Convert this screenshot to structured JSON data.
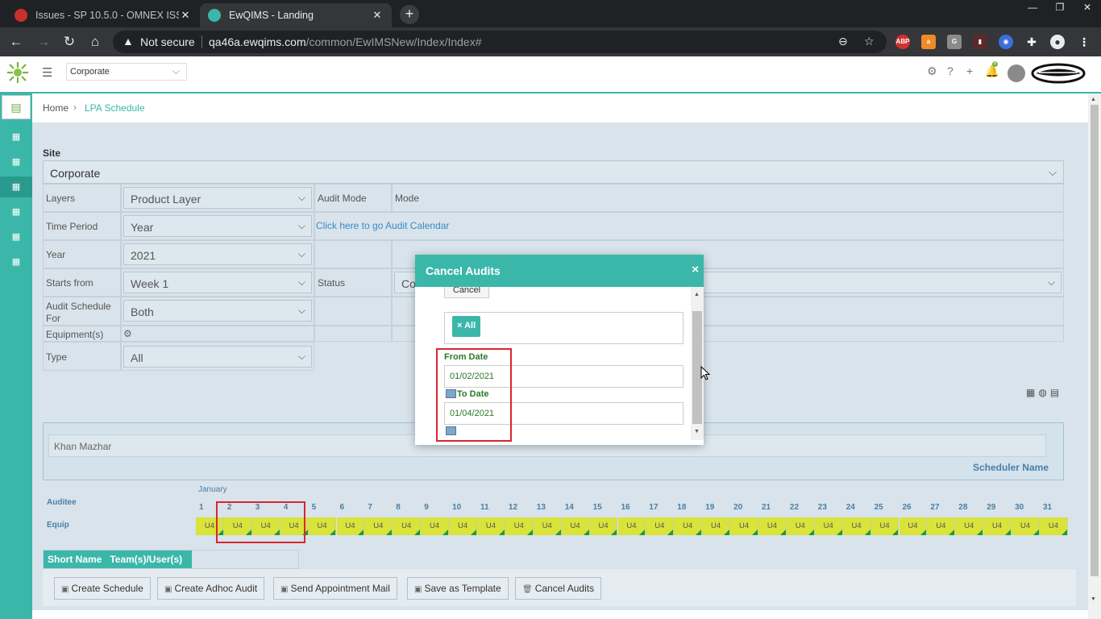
{
  "browser": {
    "tabs": [
      {
        "title": "Issues - SP 10.5.0 - OMNEX ISSUE",
        "active": false
      },
      {
        "title": "EwQIMS - Landing",
        "active": true
      }
    ],
    "new_tab": "+",
    "url_warning": "Not secure",
    "url_host": "qa46a.ewqims.com",
    "url_path": "/common/EwIMSNew/Index/Index#",
    "extensions": [
      "ABP"
    ]
  },
  "header": {
    "site_select": "Corporate",
    "brand": "CUMMINS",
    "notification_count": "0"
  },
  "breadcrumb": {
    "home": "Home",
    "separator": "›",
    "current": "LPA Schedule"
  },
  "form": {
    "site_label": "Site",
    "site_value": "Corporate",
    "layers_label": "Layers",
    "layers_value": "Product Layer",
    "audit_mode_label": "Audit Mode",
    "audit_mode_value": "Mode",
    "time_period_label": "Time Period",
    "time_period_value": "Year",
    "calendar_link": "Click here to go Audit Calendar",
    "year_label": "Year",
    "year_value": "2021",
    "starts_from_label": "Starts from",
    "starts_from_value": "Week 1",
    "status_label": "Status",
    "status_value": "Co",
    "schedule_for_label_1": "Audit Schedule",
    "schedule_for_label_2": "For",
    "schedule_for_value": "Both",
    "equipment_label": "Equipment(s)",
    "type_label": "Type",
    "type_value": "All"
  },
  "scheduler": {
    "value": "Khan Mazhar",
    "label": "Scheduler Name"
  },
  "grid": {
    "auditee_label": "Auditee",
    "month": "January",
    "days": [
      "1",
      "2",
      "3",
      "4",
      "5",
      "6",
      "7",
      "8",
      "9",
      "10",
      "11",
      "12",
      "13",
      "14",
      "15",
      "16",
      "17",
      "18",
      "19",
      "20",
      "21",
      "22",
      "23",
      "24",
      "25",
      "26",
      "27",
      "28",
      "29",
      "30",
      "31"
    ],
    "row_label": "Equip",
    "cell_value": "U4"
  },
  "short_table": {
    "header": "Short Name   Team(s)/User(s)"
  },
  "buttons": {
    "create_schedule": "Create Schedule",
    "create_adhoc": "Create Adhoc Audit",
    "send_mail": "Send Appointment Mail",
    "save_template": "Save as Template",
    "cancel_audits": "Cancel Audits"
  },
  "dialog": {
    "title": "Cancel Audits",
    "close": "×",
    "cancel_button": "Cancel",
    "chip": "× All",
    "from_label": "From Date",
    "from_value": "01/02/2021",
    "to_label": "To Date",
    "to_value": "01/04/2021"
  },
  "colors": {
    "accent": "#3bb7a9",
    "cell_fill": "#d9e33a",
    "highlight": "#d9262f"
  }
}
